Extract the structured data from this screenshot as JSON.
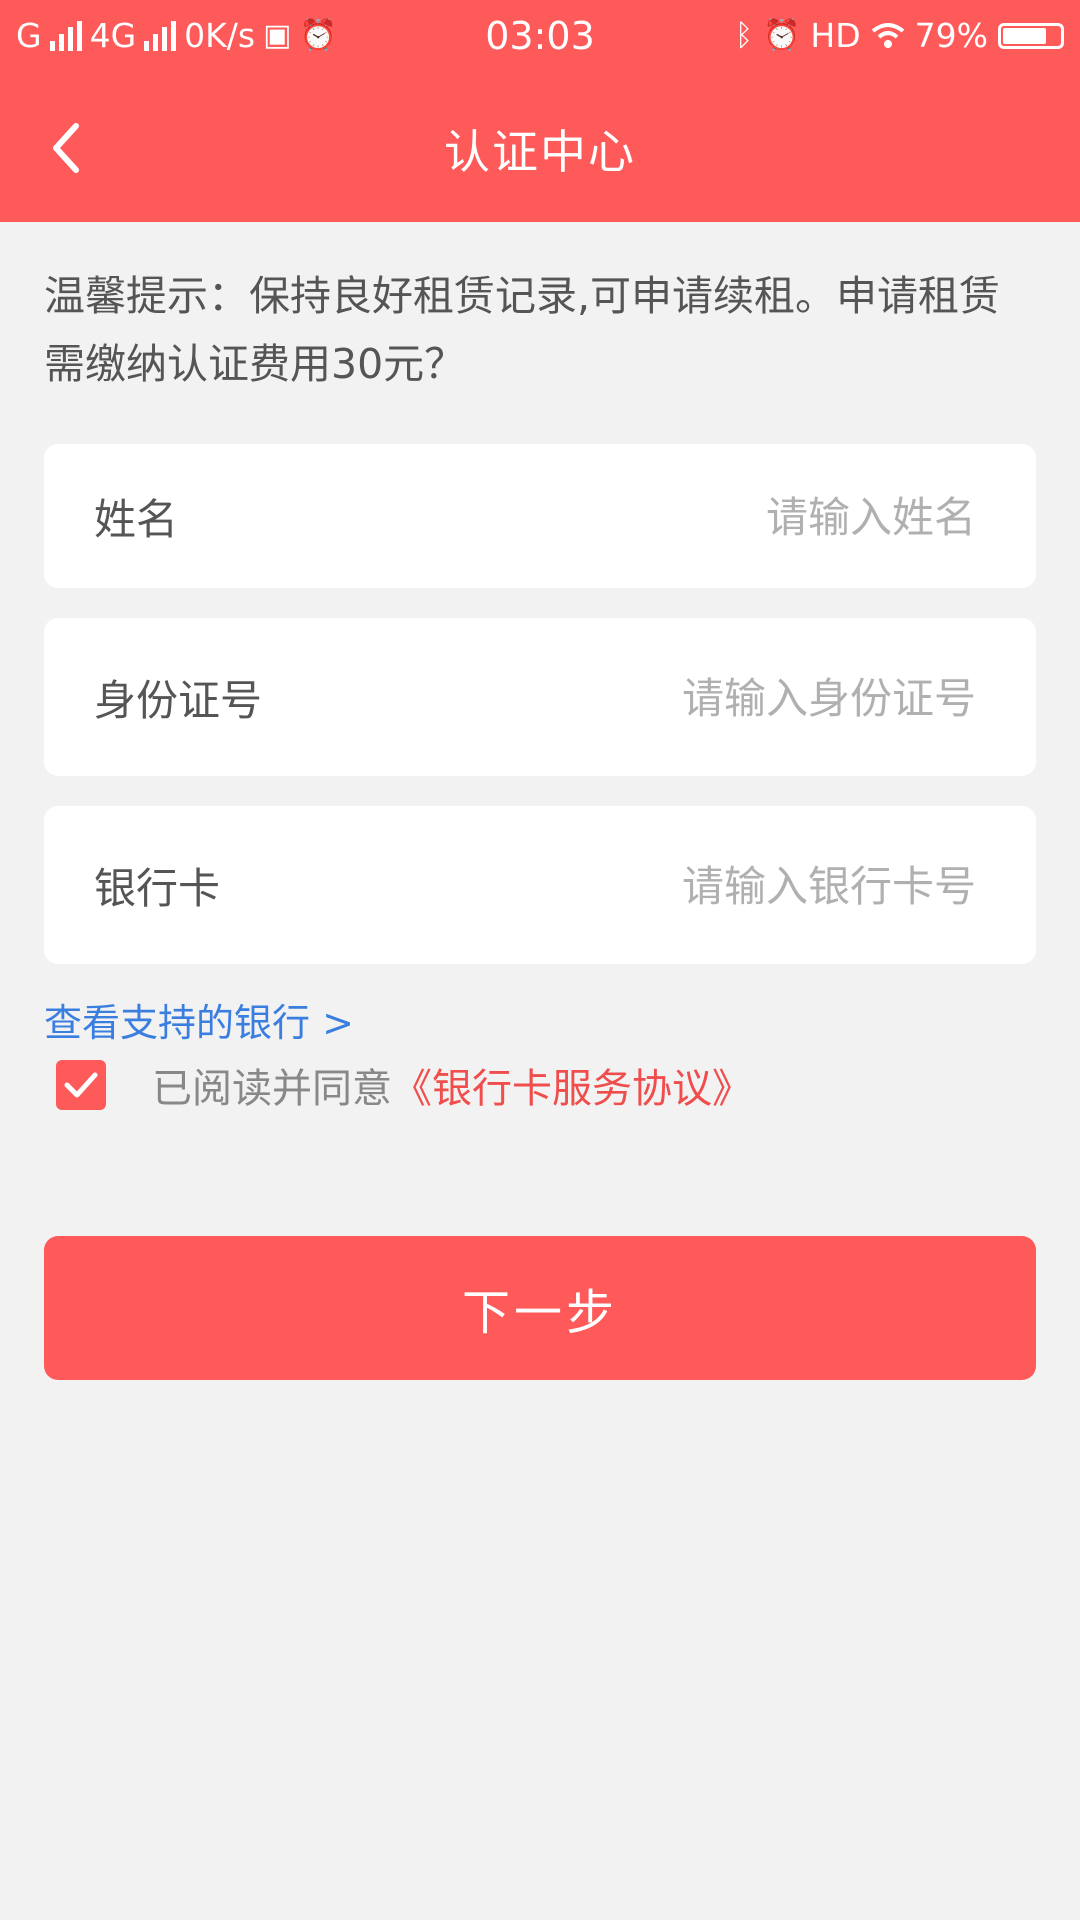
{
  "status_bar": {
    "carrier1": "G",
    "network": "4G",
    "speed": "0K/s",
    "time": "03:03",
    "hd": "HD",
    "battery_text": "79%",
    "battery_level": 0.79
  },
  "nav": {
    "title": "认证中心"
  },
  "tip": "温馨提示：保持良好租赁记录,可申请续租。申请租赁需缴纳认证费用30元？",
  "form": {
    "name": {
      "label": "姓名",
      "placeholder": "请输入姓名",
      "value": ""
    },
    "id_number": {
      "label": "身份证号",
      "placeholder": "请输入身份证号",
      "value": ""
    },
    "bank_card": {
      "label": "银行卡",
      "placeholder": "请输入银行卡号",
      "value": ""
    }
  },
  "supported_banks_link": "查看支持的银行 >",
  "agreement": {
    "checked": true,
    "text": "已阅读并同意",
    "link": "《银行卡服务协议》"
  },
  "next_button": "下一步",
  "colors": {
    "primary": "#fe5a5a",
    "link_blue": "#3a7ee0",
    "background": "#f2f2f2"
  }
}
